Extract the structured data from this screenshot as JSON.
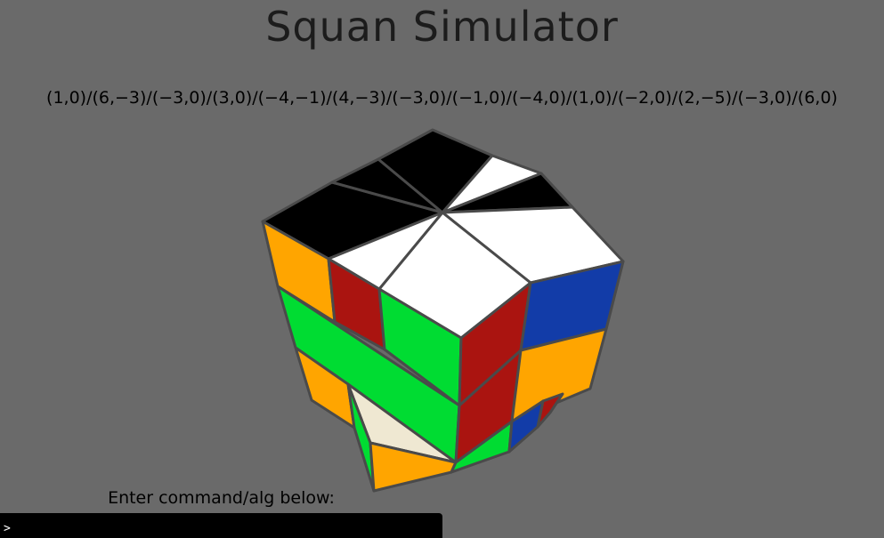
{
  "app": {
    "title": "Squan Simulator",
    "scramble": "(1,0)/(6,−3)/(−3,0)/(3,0)/(−4,−1)/(4,−3)/(−3,0)/(−1,0)/(−4,0)/(1,0)/(−2,0)/(2,−5)/(−3,0)/(6,0)"
  },
  "command": {
    "label": "Enter command/alg below:",
    "prompt": ">",
    "value": ""
  },
  "colors": {
    "background": "#6a6a6a",
    "edge": "#4a4a4a",
    "black": "#000000",
    "white": "#ffffff",
    "cream": "#efe8d2",
    "orange": "#ffa500",
    "green": "#00dc32",
    "red": "#aa1410",
    "blue": "#123ca8"
  }
}
